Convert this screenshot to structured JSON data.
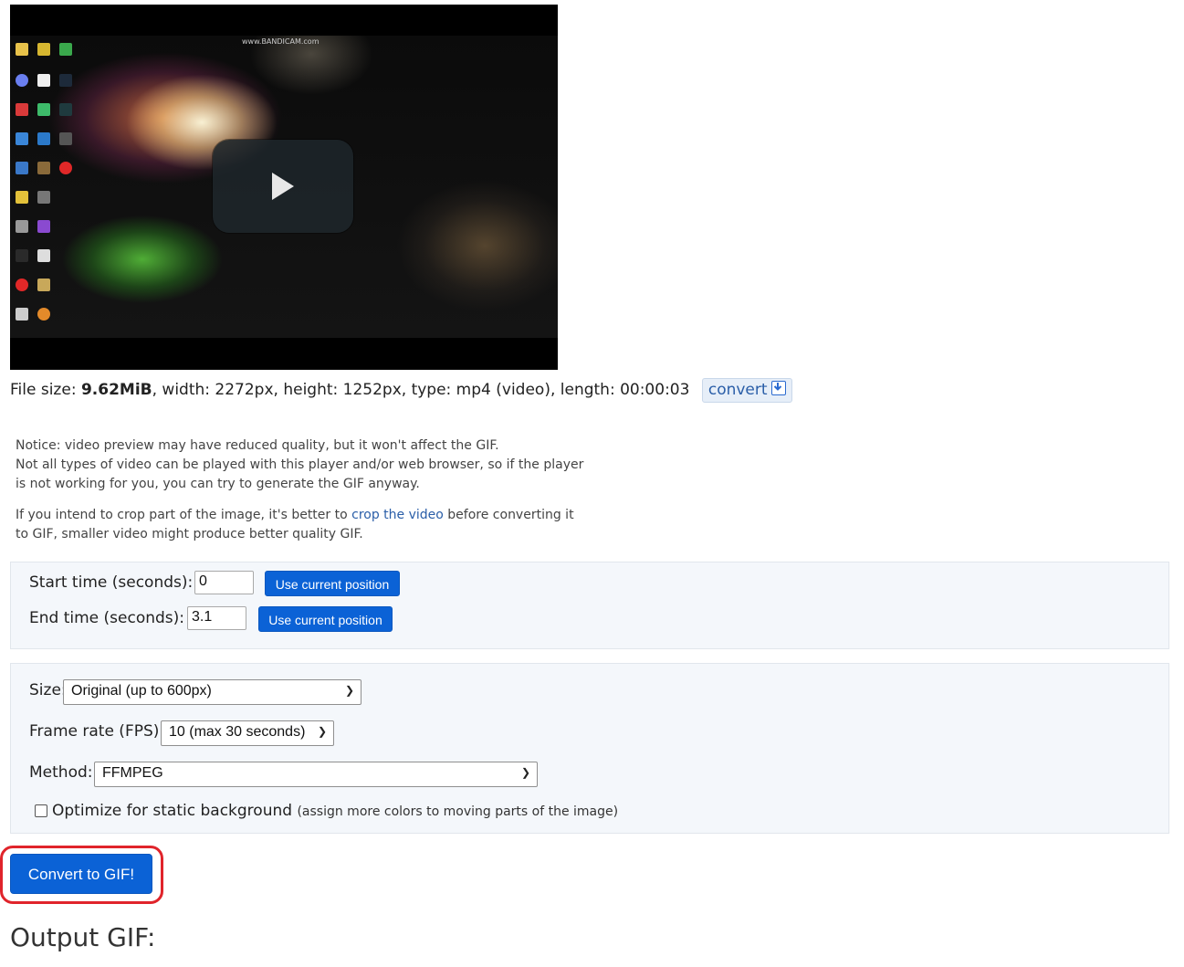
{
  "video": {
    "watermark": "www.BANDICAM.com",
    "play_icon": "play-icon"
  },
  "file_info": {
    "prefix": "File size: ",
    "size": "9.62MiB",
    "rest": ", width: 2272px, height: 1252px, type: mp4 (video), length: 00:00:03",
    "convert_label": "convert",
    "convert_icon": "download-icon"
  },
  "notice": {
    "line1": "Notice: video preview may have reduced quality, but it won't affect the GIF.",
    "line2": "Not all types of video can be played with this player and/or web browser, so if the player",
    "line3": "is not working for you, you can try to generate the GIF anyway.",
    "crop_before": "If you intend to crop part of the image, it's better to ",
    "crop_link": "crop the video",
    "crop_after": " before converting it",
    "crop_line2": "to GIF, smaller video might produce better quality GIF."
  },
  "timing": {
    "start_label": "Start time (seconds):",
    "start_value": "0",
    "end_label": "End time (seconds):",
    "end_value": "3.1",
    "use_current_label": "Use current position"
  },
  "options": {
    "size_label": "Size:",
    "size_value": "Original (up to 600px)",
    "fps_label": "Frame rate (FPS):",
    "fps_value": "10 (max 30 seconds)",
    "method_label": "Method:",
    "method_value": "FFMPEG",
    "optimize_label": "Optimize for static background",
    "optimize_note": "(assign more colors to moving parts of the image)",
    "optimize_checked": false
  },
  "convert_button": "Convert to GIF!",
  "output_title": "Output GIF:",
  "colors": {
    "primary": "#0b62d6",
    "highlight": "#e0242b",
    "panel_bg": "#f4f7fb"
  }
}
